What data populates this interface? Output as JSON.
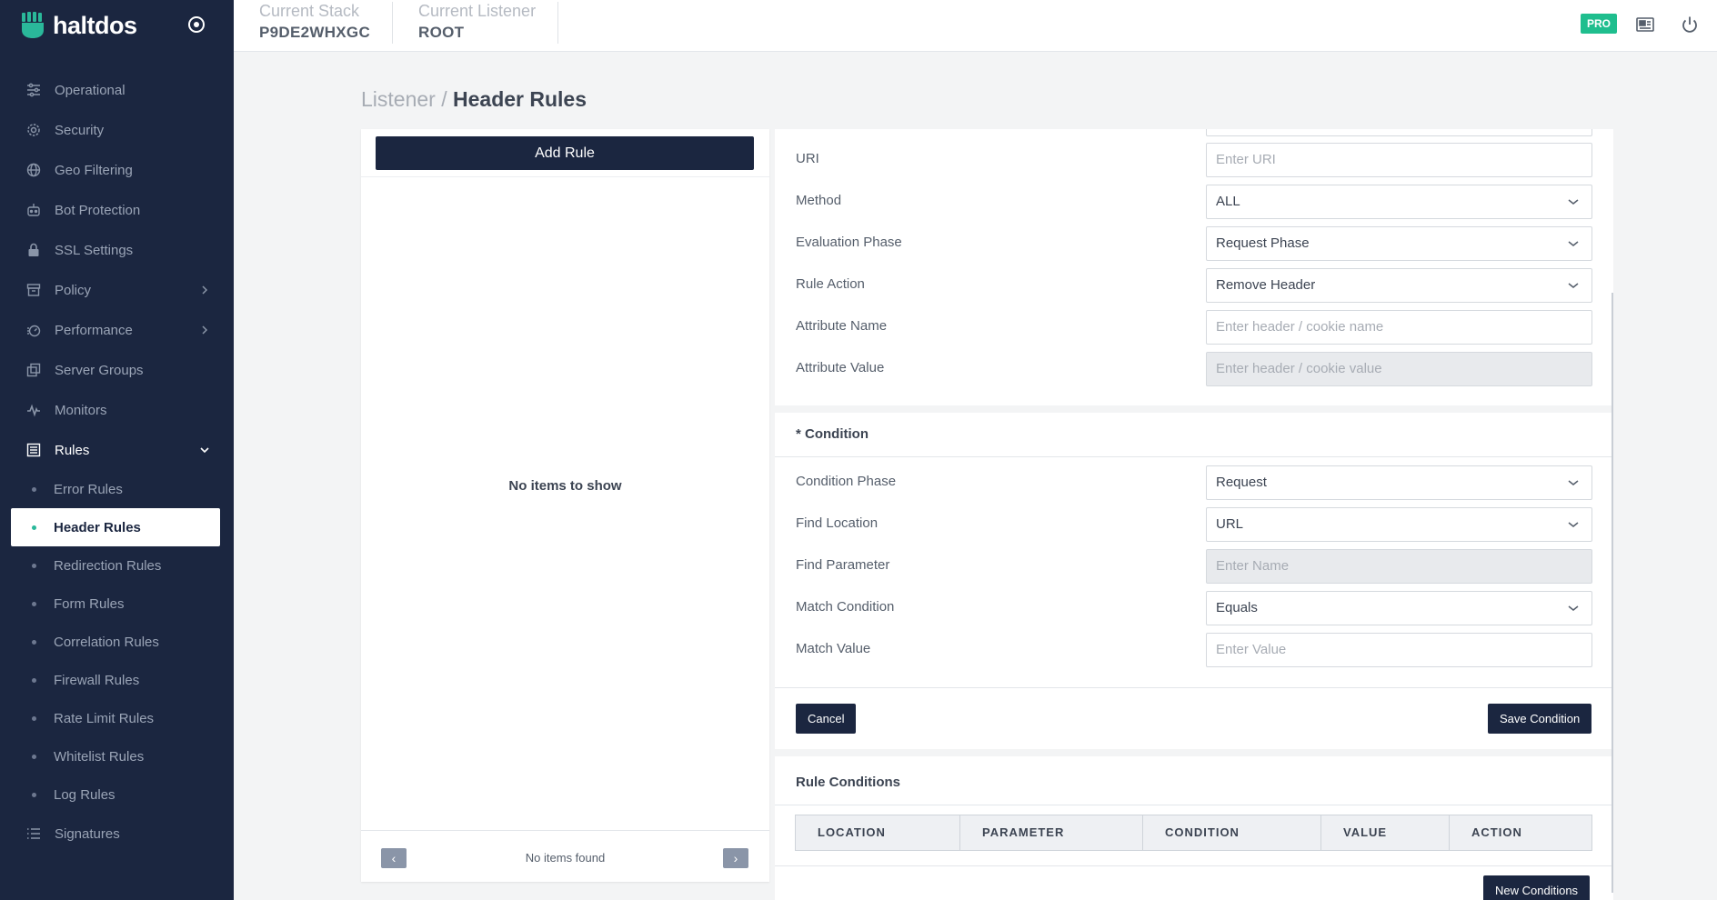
{
  "app": {
    "brand": "haltdos"
  },
  "sidebar": {
    "items": [
      {
        "label": "Operational",
        "icon": "sliders-icon"
      },
      {
        "label": "Security",
        "icon": "gear-icon"
      },
      {
        "label": "Geo Filtering",
        "icon": "globe-icon"
      },
      {
        "label": "Bot Protection",
        "icon": "bot-icon"
      },
      {
        "label": "SSL Settings",
        "icon": "lock-icon"
      },
      {
        "label": "Policy",
        "icon": "archive-icon"
      },
      {
        "label": "Performance",
        "icon": "speedometer-icon"
      },
      {
        "label": "Server Groups",
        "icon": "copy-icon"
      },
      {
        "label": "Monitors",
        "icon": "pulse-icon"
      },
      {
        "label": "Rules",
        "icon": "list-box-icon"
      }
    ],
    "sub_items": [
      {
        "label": "Error Rules"
      },
      {
        "label": "Header Rules"
      },
      {
        "label": "Redirection Rules"
      },
      {
        "label": "Form Rules"
      },
      {
        "label": "Correlation Rules"
      },
      {
        "label": "Firewall Rules"
      },
      {
        "label": "Rate Limit Rules"
      },
      {
        "label": "Whitelist Rules"
      },
      {
        "label": "Log Rules"
      }
    ],
    "signatures": {
      "label": "Signatures",
      "icon": "list-icon"
    },
    "active_sub": "Header Rules"
  },
  "topbar": {
    "stack_label": "Current Stack",
    "stack_value": "P9DE2WHXGC",
    "listener_label": "Current Listener",
    "listener_value": "ROOT",
    "badge": "PRO"
  },
  "page": {
    "breadcrumb_parent": "Listener /",
    "breadcrumb_current": "Header Rules"
  },
  "rules_panel": {
    "add_button": "Add Rule",
    "empty_text": "No items to show",
    "footer_text": "No items found",
    "prev": "‹",
    "next": "›"
  },
  "rule_form": {
    "uri": {
      "label": "URI",
      "placeholder": "Enter URI"
    },
    "method": {
      "label": "Method",
      "value": "ALL"
    },
    "phase": {
      "label": "Evaluation Phase",
      "value": "Request Phase"
    },
    "action": {
      "label": "Rule Action",
      "value": "Remove Header"
    },
    "attr_name": {
      "label": "Attribute Name",
      "placeholder": "Enter header / cookie name"
    },
    "attr_value": {
      "label": "Attribute Value",
      "placeholder": "Enter header / cookie value"
    }
  },
  "condition": {
    "title": "* Condition",
    "phase": {
      "label": "Condition Phase",
      "value": "Request"
    },
    "location": {
      "label": "Find Location",
      "value": "URL"
    },
    "parameter": {
      "label": "Find Parameter",
      "placeholder": "Enter Name"
    },
    "match": {
      "label": "Match Condition",
      "value": "Equals"
    },
    "match_value": {
      "label": "Match Value",
      "placeholder": "Enter Value"
    },
    "cancel": "Cancel",
    "save": "Save Condition"
  },
  "rule_conditions": {
    "title": "Rule Conditions",
    "columns": [
      "LOCATION",
      "PARAMETER",
      "CONDITION",
      "VALUE",
      "ACTION"
    ],
    "new_button": "New Conditions"
  }
}
